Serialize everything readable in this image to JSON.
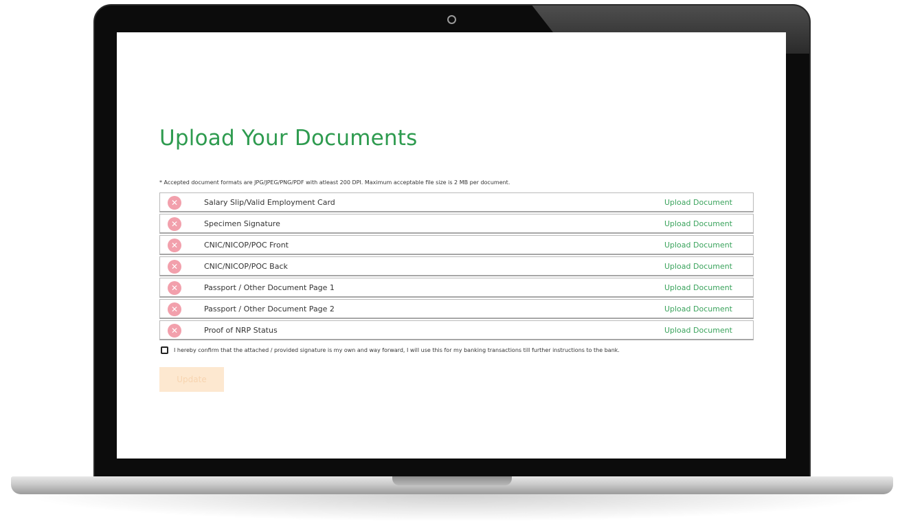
{
  "page": {
    "title": "Upload Your Documents",
    "note": "* Accepted document formats are JPG/JPEG/PNG/PDF with atleast 200 DPI. Maximum acceptable file size is 2 MB per document."
  },
  "documents": [
    {
      "label": "Salary Slip/Valid Employment Card",
      "action": "Upload Document",
      "status_icon": "close-icon"
    },
    {
      "label": "Specimen Signature",
      "action": "Upload Document",
      "status_icon": "close-icon"
    },
    {
      "label": "CNIC/NICOP/POC Front",
      "action": "Upload Document",
      "status_icon": "close-icon"
    },
    {
      "label": "CNIC/NICOP/POC Back",
      "action": "Upload Document",
      "status_icon": "close-icon"
    },
    {
      "label": "Passport / Other Document Page 1",
      "action": "Upload Document",
      "status_icon": "close-icon"
    },
    {
      "label": "Passport / Other Document Page 2",
      "action": "Upload Document",
      "status_icon": "close-icon"
    },
    {
      "label": "Proof of NRP Status",
      "action": "Upload Document",
      "status_icon": "close-icon"
    }
  ],
  "confirm": {
    "checked": false,
    "text": "I hereby confirm that the attached / provided signature is my own and way forward, I will use this for my banking transactions till further instructions to the bank."
  },
  "update_button": {
    "label": "Update"
  },
  "colors": {
    "title": "#2e9b4f",
    "link": "#3aa35c",
    "status_icon_bg": "#f2a0ac",
    "button_bg": "#fde8d0"
  }
}
